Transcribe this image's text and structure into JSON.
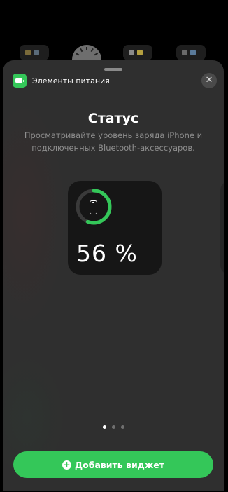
{
  "colors": {
    "accent": "#34c759",
    "sheet": "#2f2f2f",
    "widget": "#161616",
    "subtitle": "#8e8e8e"
  },
  "app": {
    "name": "Элементы питания",
    "icon": "battery-icon"
  },
  "close": {
    "label": "✕",
    "icon": "close-icon"
  },
  "sheet": {
    "title": "Статус",
    "subtitle": "Просматривайте уровень заряда iPhone и подключенных Bluetooth-аксессуаров."
  },
  "widget": {
    "device_icon": "iphone-icon",
    "battery_level": 0.56,
    "percent_text": "56 %"
  },
  "pagination": {
    "total": 3,
    "current": 1
  },
  "add_button": {
    "label": "Добавить виджет",
    "icon": "plus-circle-icon",
    "plus": "+"
  }
}
